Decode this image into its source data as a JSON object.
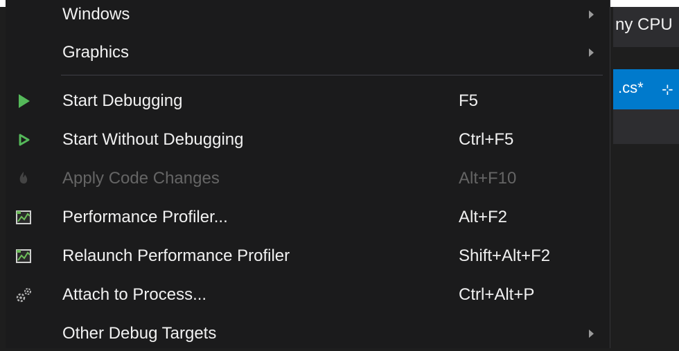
{
  "background": {
    "toolbar_text": "ny CPU",
    "tab_text": ".cs*",
    "pin_glyph": "⊹"
  },
  "menu": {
    "items": [
      {
        "label": "Windows",
        "shortcut": "",
        "submenu": true,
        "icon": "",
        "enabled": true
      },
      {
        "label": "Graphics",
        "shortcut": "",
        "submenu": true,
        "icon": "",
        "enabled": true
      },
      {
        "label": "Start Debugging",
        "shortcut": "F5",
        "submenu": false,
        "icon": "play-filled-icon",
        "enabled": true
      },
      {
        "label": "Start Without Debugging",
        "shortcut": "Ctrl+F5",
        "submenu": false,
        "icon": "play-outline-icon",
        "enabled": true
      },
      {
        "label": "Apply Code Changes",
        "shortcut": "Alt+F10",
        "submenu": false,
        "icon": "flame-icon",
        "enabled": false
      },
      {
        "label": "Performance Profiler...",
        "shortcut": "Alt+F2",
        "submenu": false,
        "icon": "profiler-icon",
        "enabled": true
      },
      {
        "label": "Relaunch Performance Profiler",
        "shortcut": "Shift+Alt+F2",
        "submenu": false,
        "icon": "profiler-icon",
        "enabled": true
      },
      {
        "label": "Attach to Process...",
        "shortcut": "Ctrl+Alt+P",
        "submenu": false,
        "icon": "gears-icon",
        "enabled": true
      },
      {
        "label": "Other Debug Targets",
        "shortcut": "",
        "submenu": true,
        "icon": "",
        "enabled": true
      }
    ]
  },
  "colors": {
    "menu_bg": "#1b1b1c",
    "text": "#f1f1f1",
    "disabled_text": "#656565",
    "play_green": "#55b95a",
    "accent_blue": "#007acc"
  }
}
